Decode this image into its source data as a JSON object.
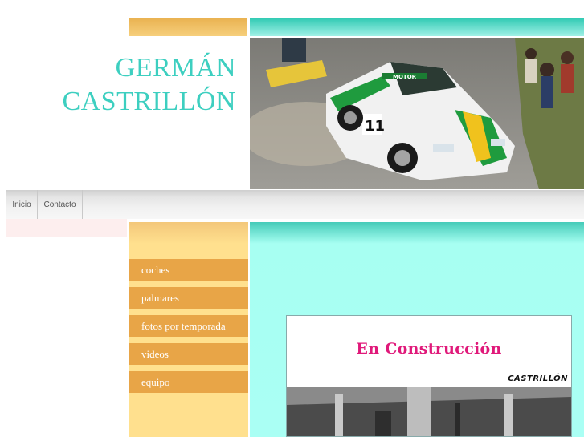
{
  "site": {
    "title_line1": "GERMÁN",
    "title_line2": "CASTRILLÓN"
  },
  "nav": {
    "items": [
      {
        "label": "Inicio"
      },
      {
        "label": "Contacto"
      }
    ]
  },
  "sidebar": {
    "menu": [
      {
        "label": "coches"
      },
      {
        "label": "palmares"
      },
      {
        "label": "fotos por temporada"
      },
      {
        "label": "videos"
      },
      {
        "label": "equipo"
      }
    ]
  },
  "main": {
    "construction_text": "En Construcción",
    "construction_logo": "CASTRILLÓN"
  },
  "hero": {
    "car_sponsor": "MOTOR",
    "car_number": "11"
  },
  "colors": {
    "title": "#3dcfc0",
    "menu_item": "#e8a547",
    "sidebar": "#ffe08e",
    "content": "#aafff4",
    "construction_text": "#e0197a"
  }
}
